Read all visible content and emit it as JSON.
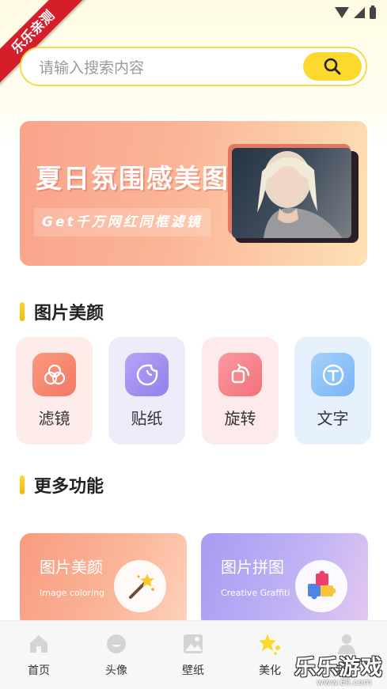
{
  "ribbon": "乐乐亲测",
  "search": {
    "placeholder": "请输入搜索内容"
  },
  "banner": {
    "title": "夏日氛围感美图",
    "subtitle": "Get千万网红同框滤镜"
  },
  "section_beauty": "图片美颜",
  "tools": [
    {
      "label": "滤镜",
      "icon": "filter-icon"
    },
    {
      "label": "贴纸",
      "icon": "sticker-icon"
    },
    {
      "label": "旋转",
      "icon": "rotate-icon"
    },
    {
      "label": "文字",
      "icon": "text-icon"
    }
  ],
  "section_more": "更多功能",
  "more": [
    {
      "title": "图片美颜",
      "subtitle": "Image coloring",
      "icon": "magic-wand-icon"
    },
    {
      "title": "图片拼图",
      "subtitle": "Creative Graffiti",
      "icon": "puzzle-icon"
    }
  ],
  "nav": [
    {
      "label": "首页",
      "icon": "home-icon"
    },
    {
      "label": "头像",
      "icon": "avatar-icon"
    },
    {
      "label": "壁纸",
      "icon": "wallpaper-icon"
    },
    {
      "label": "美化",
      "icon": "star-icon",
      "active": true
    },
    {
      "label": "我的",
      "icon": "user-icon"
    }
  ],
  "watermark": {
    "text": "乐乐游戏",
    "url": "www.6ll.com"
  },
  "colors": {
    "accent": "#fcd92d",
    "banner_start": "#f9a38a",
    "banner_end": "#fde1b4"
  }
}
